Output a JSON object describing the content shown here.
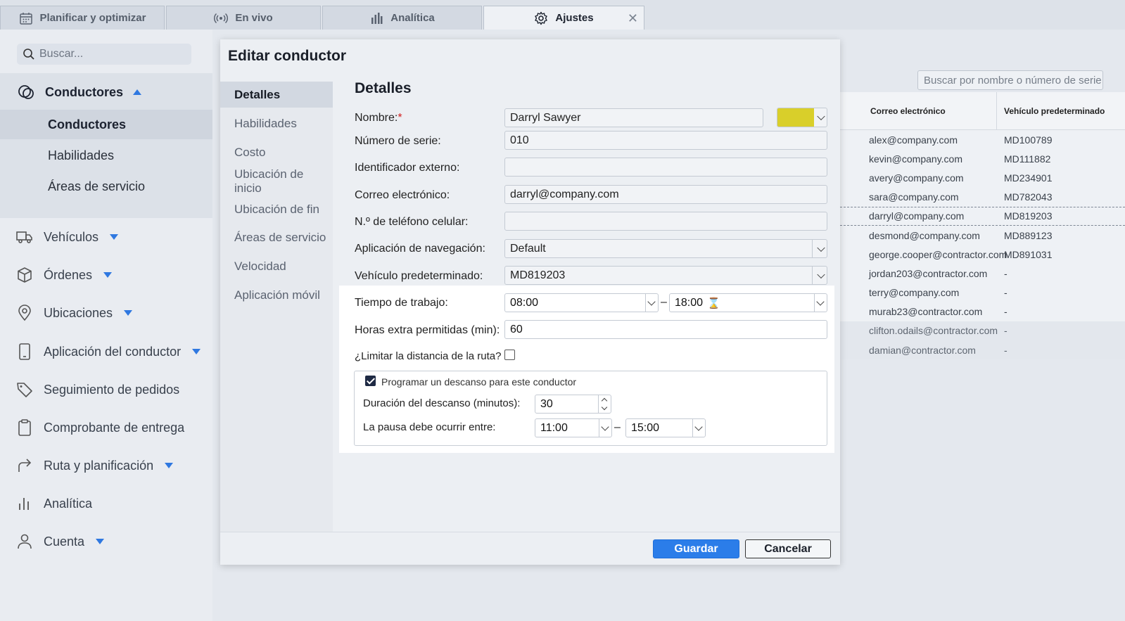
{
  "tabs": [
    {
      "label": "Planificar y optimizar",
      "icon": "calendar-icon"
    },
    {
      "label": "En vivo",
      "icon": "broadcast-icon"
    },
    {
      "label": "Analítica",
      "icon": "bar-chart-icon"
    },
    {
      "label": "Ajustes",
      "icon": "gear-icon"
    }
  ],
  "sidebar": {
    "search_placeholder": "Buscar...",
    "group": {
      "label": "Conductores",
      "items": [
        "Conductores",
        "Habilidades",
        "Áreas de servicio"
      ],
      "active": "Conductores"
    },
    "items": [
      {
        "label": "Vehículos",
        "icon": "truck-icon"
      },
      {
        "label": "Órdenes",
        "icon": "box-icon"
      },
      {
        "label": "Ubicaciones",
        "icon": "location-pin-icon"
      },
      {
        "label": "Aplicación del conductor",
        "icon": "phone-icon"
      },
      {
        "label": "Seguimiento de pedidos",
        "icon": "tag-icon"
      },
      {
        "label": "Comprobante de entrega",
        "icon": "clipboard-icon"
      },
      {
        "label": "Ruta y planificación",
        "icon": "route-arrow-icon"
      },
      {
        "label": "Analítica",
        "icon": "bar-chart-icon"
      },
      {
        "label": "Cuenta",
        "icon": "user-icon"
      }
    ]
  },
  "table": {
    "search_placeholder": "Buscar por nombre o número de serie",
    "headers": [
      "Correo electrónico",
      "Vehículo predeterminado"
    ],
    "rows": [
      [
        "alex@company.com",
        "MD100789"
      ],
      [
        "kevin@company.com",
        "MD111882"
      ],
      [
        "avery@company.com",
        "MD234901"
      ],
      [
        "sara@company.com",
        "MD782043"
      ],
      [
        "darryl@company.com",
        "MD819203"
      ],
      [
        "desmond@company.com",
        "MD889123"
      ],
      [
        "george.cooper@contractor.com",
        "MD891031"
      ],
      [
        "jordan203@contractor.com",
        "-"
      ],
      [
        "terry@company.com",
        "-"
      ],
      [
        "murab23@contractor.com",
        "-"
      ],
      [
        "clifton.odails@contractor.com",
        "-"
      ],
      [
        "damian@contractor.com",
        "-"
      ]
    ]
  },
  "modal": {
    "title": "Editar conductor",
    "nav": [
      "Detalles",
      "Habilidades",
      "Costo",
      "Ubicación de inicio",
      "Ubicación de fin",
      "Áreas de servicio",
      "Velocidad",
      "Aplicación móvil"
    ],
    "section_title": "Detalles",
    "fields": {
      "name_label": "Nombre:",
      "name_required": "*",
      "name_value": "Darryl Sawyer",
      "color": "#d9cf2a",
      "serial_label": "Número de serie:",
      "serial_value": "010",
      "external_id_label": "Identificador externo:",
      "external_id_value": "",
      "email_label": "Correo electrónico:",
      "email_value": "darryl@company.com",
      "phone_label": "N.º de teléfono celular:",
      "phone_value": "",
      "nav_app_label": "Aplicación de navegación:",
      "nav_app_value": "Default",
      "vehicle_label": "Vehículo predeterminado:",
      "vehicle_value": "MD819203",
      "work_time_label": "Tiempo de trabajo:",
      "work_start": "08:00",
      "work_end": "18:00",
      "overtime_label": "Horas extra permitidas (min):",
      "overtime_value": "60",
      "limit_distance_label": "¿Limitar la distancia de la ruta?",
      "limit_distance_checked": false,
      "break_checkbox_label": "Programar un descanso para este conductor",
      "break_checked": true,
      "break_duration_label": "Duración del descanso (minutos):",
      "break_duration_value": "30",
      "break_window_label": "La pausa debe ocurrir entre:",
      "break_start": "11:00",
      "break_end": "15:00"
    },
    "save_label": "Guardar",
    "cancel_label": "Cancelar"
  }
}
